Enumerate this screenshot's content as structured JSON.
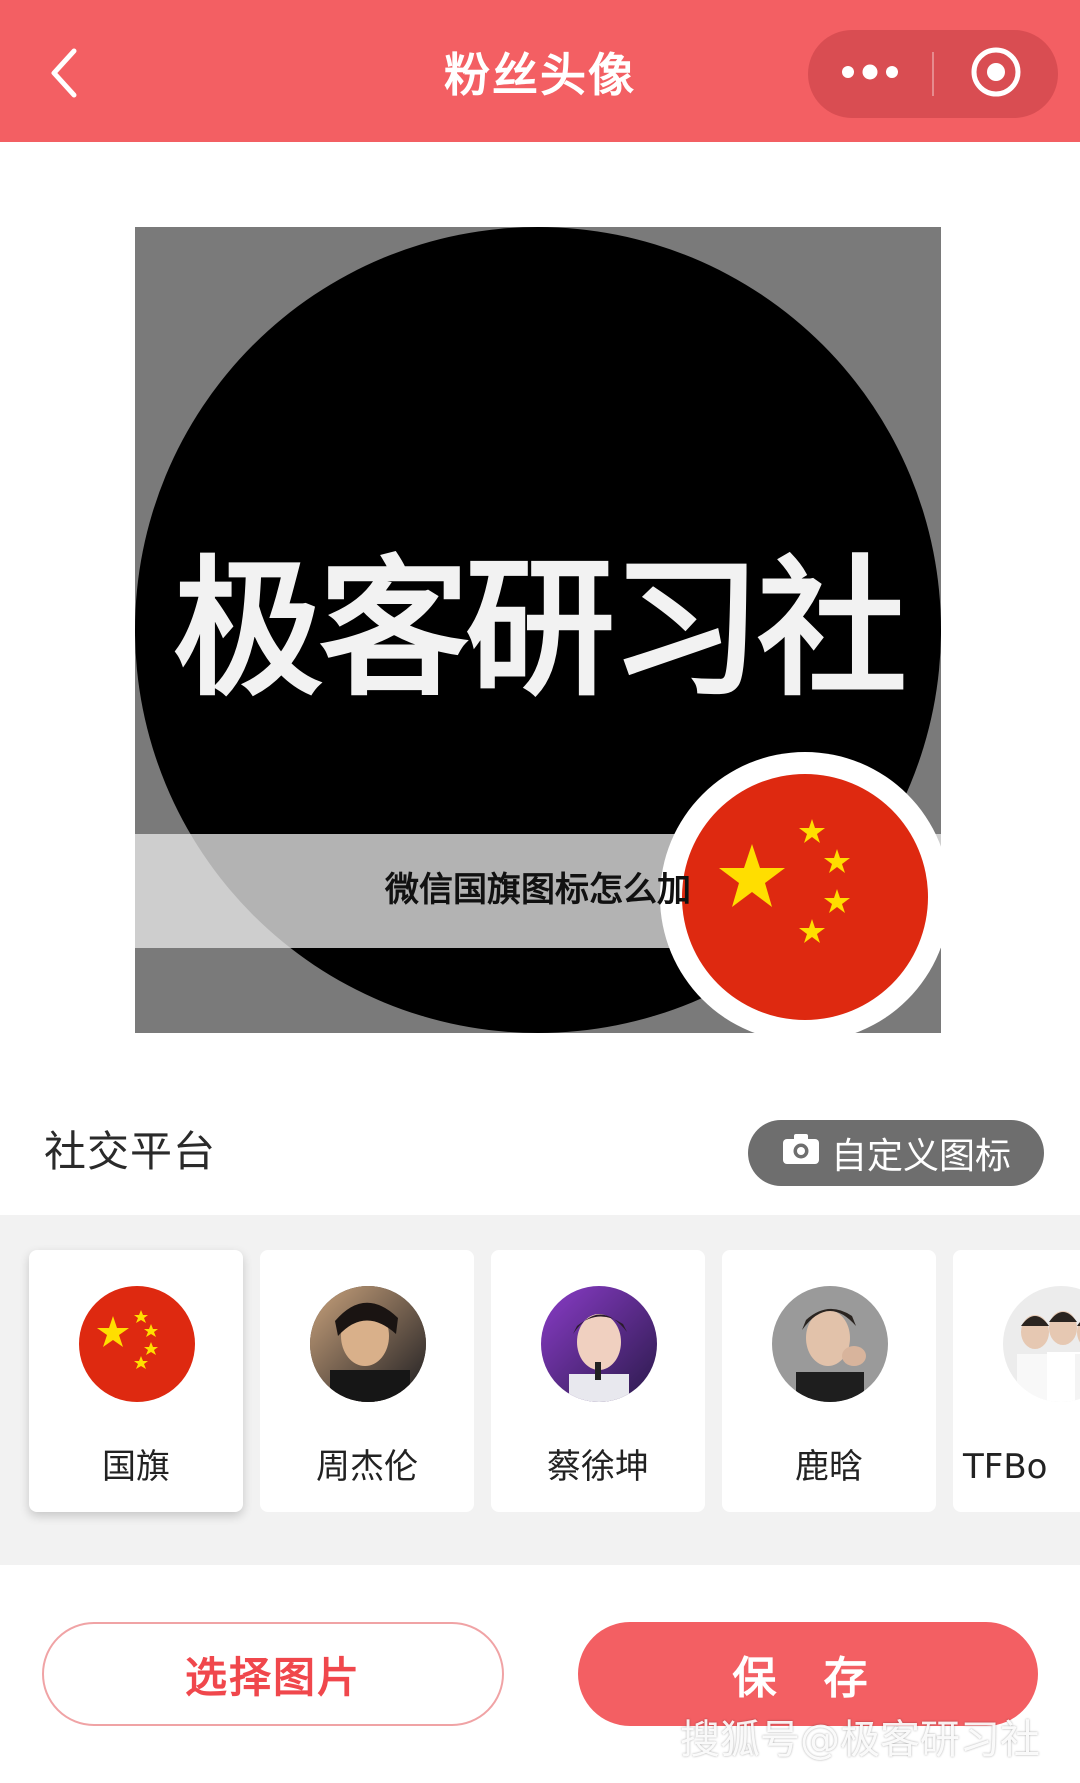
{
  "header": {
    "title": "粉丝头像",
    "back_icon": "chevron-left-icon",
    "more_icon": "more-dots-icon",
    "close_icon": "target-close-icon"
  },
  "preview": {
    "avatar_text": "极客研习社",
    "caption": "微信国旗图标怎么加",
    "badge": "china-flag"
  },
  "section": {
    "title": "社交平台",
    "custom_icon": "camera-icon",
    "custom_label": "自定义图标"
  },
  "templates": [
    {
      "label": "国旗",
      "thumb": "china-flag",
      "selected": true
    },
    {
      "label": "周杰伦",
      "thumb": "portrait",
      "selected": false
    },
    {
      "label": "蔡徐坤",
      "thumb": "portrait",
      "selected": false
    },
    {
      "label": "鹿晗",
      "thumb": "portrait",
      "selected": false
    },
    {
      "label": "TFBo",
      "thumb": "portrait",
      "selected": false
    }
  ],
  "actions": {
    "select_label": "选择图片",
    "save_label": "保 存"
  },
  "watermark": "搜狐号@极客研习社",
  "colors": {
    "primary": "#f35f63",
    "flag_red": "#de2910",
    "flag_yellow": "#ffde00"
  }
}
